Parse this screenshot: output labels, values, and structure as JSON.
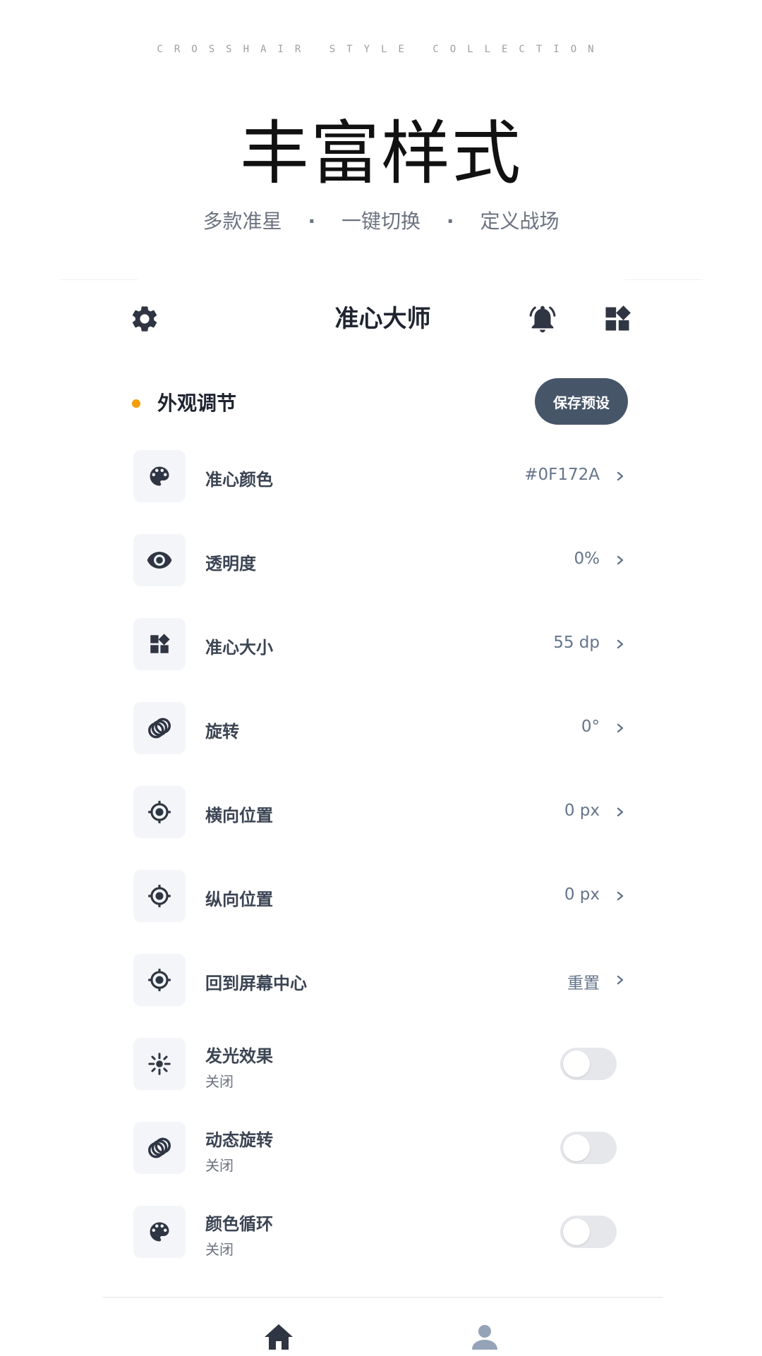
{
  "promo": {
    "eyebrow": "CROSSHAIR STYLE COLLECTION",
    "title": "丰富样式",
    "subtitle": {
      "part1": "多款准星",
      "part2": "一键切换",
      "part3": "定义战场",
      "separator": "·"
    }
  },
  "app": {
    "title": "准心大师",
    "icons": {
      "left": "gear-icon",
      "bell": "bell-icon",
      "apps": "widgets-icon"
    }
  },
  "section": {
    "title": "外观调节",
    "accent_color": "#f59e0b",
    "save_button": "保存预设"
  },
  "settings": [
    {
      "icon": "palette-icon",
      "label": "准心颜色",
      "value": "#0F172A"
    },
    {
      "icon": "eye-icon",
      "label": "透明度",
      "value": "0%"
    },
    {
      "icon": "widgets-icon",
      "label": "准心大小",
      "value": "55 dp"
    },
    {
      "icon": "rings-icon",
      "label": "旋转",
      "value": "0°"
    },
    {
      "icon": "target-icon",
      "label": "横向位置",
      "value": "0 px"
    },
    {
      "icon": "target-icon",
      "label": "纵向位置",
      "value": "0 px"
    },
    {
      "icon": "target-icon",
      "label": "回到屏幕中心",
      "value": "重置"
    },
    {
      "icon": "sun-icon",
      "label": "发光效果",
      "sub": "关闭",
      "toggle": false
    },
    {
      "icon": "rings-icon",
      "label": "动态旋转",
      "sub": "关闭",
      "toggle": false
    },
    {
      "icon": "palette-icon",
      "label": "颜色循环",
      "sub": "关闭",
      "toggle": false
    }
  ],
  "bottom_nav": {
    "home": "home-icon",
    "profile": "person-icon"
  },
  "colors": {
    "primary": "#475569",
    "icon": "#2f3542",
    "muted": "#64748b"
  }
}
